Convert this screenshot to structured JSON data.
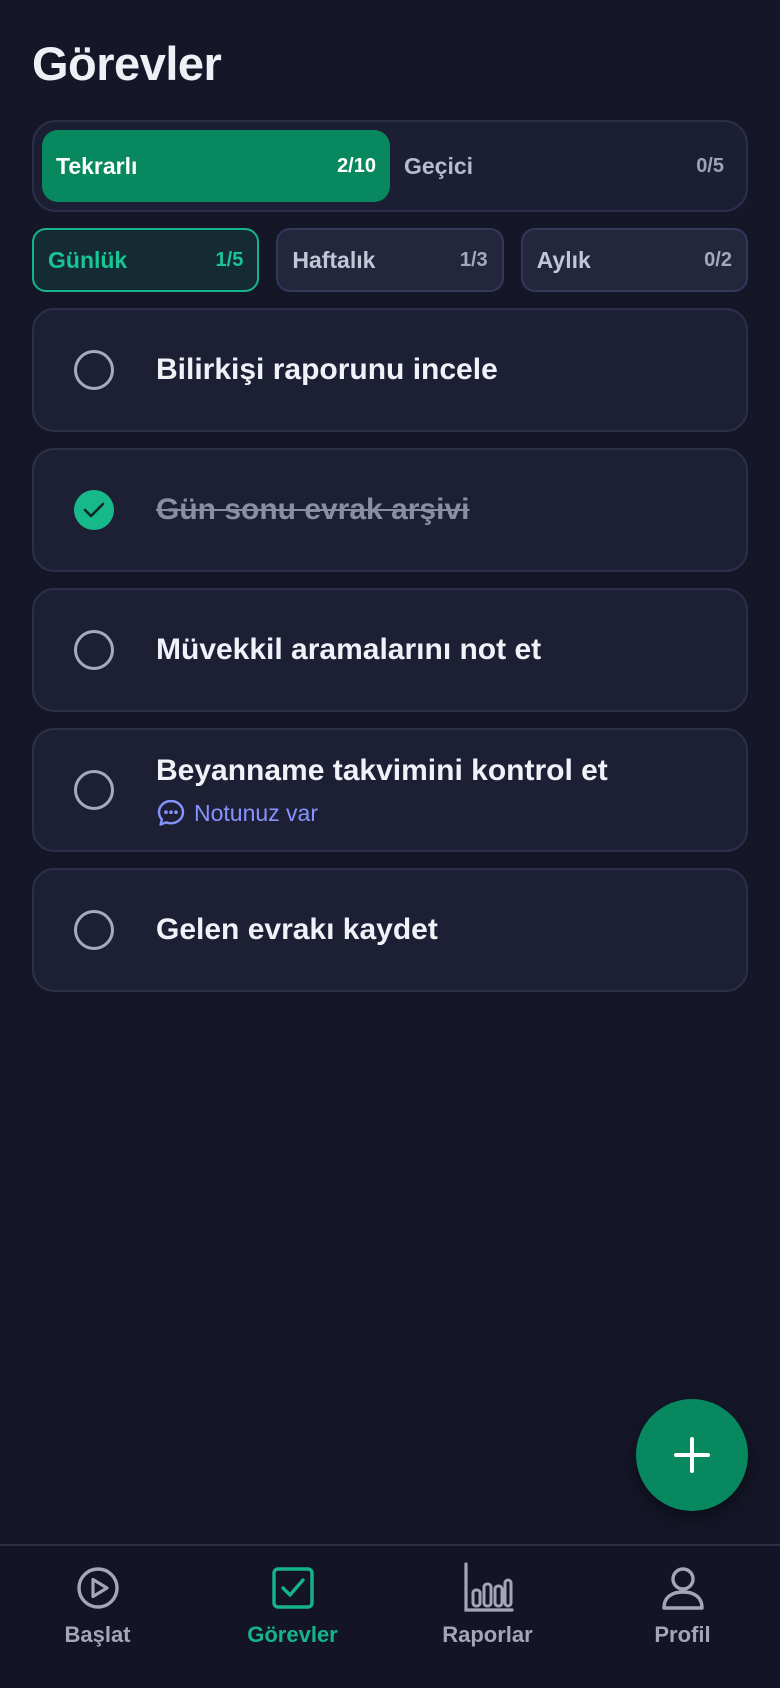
{
  "header": {
    "title": "Görevler"
  },
  "segments": [
    {
      "label": "Tekrarlı",
      "count": "2/10",
      "active": true
    },
    {
      "label": "Geçici",
      "count": "0/5",
      "active": false
    }
  ],
  "filters": [
    {
      "label": "Günlük",
      "count": "1/5",
      "active": true
    },
    {
      "label": "Haftalık",
      "count": "1/3",
      "active": false
    },
    {
      "label": "Aylık",
      "count": "0/2",
      "active": false
    }
  ],
  "tasks": [
    {
      "title": "Bilirkişi raporunu incele",
      "done": false
    },
    {
      "title": "Gün sonu evrak arşivi",
      "done": true
    },
    {
      "title": "Müvekkil aramalarını not et",
      "done": false
    },
    {
      "title": "Beyanname takvimini kontrol et",
      "done": false,
      "note": "Notunuz var"
    },
    {
      "title": "Gelen evrakı kaydet",
      "done": false
    }
  ],
  "fab": {
    "icon": "plus-icon"
  },
  "nav": [
    {
      "label": "Başlat",
      "icon": "play-circle-icon",
      "active": false
    },
    {
      "label": "Görevler",
      "icon": "check-square-icon",
      "active": true
    },
    {
      "label": "Raporlar",
      "icon": "bar-chart-icon",
      "active": false
    },
    {
      "label": "Profil",
      "icon": "user-icon",
      "active": false
    }
  ],
  "colors": {
    "background": "#151729",
    "accent": "#07885f",
    "accent_light": "#16b48a",
    "note": "#8693ff"
  }
}
